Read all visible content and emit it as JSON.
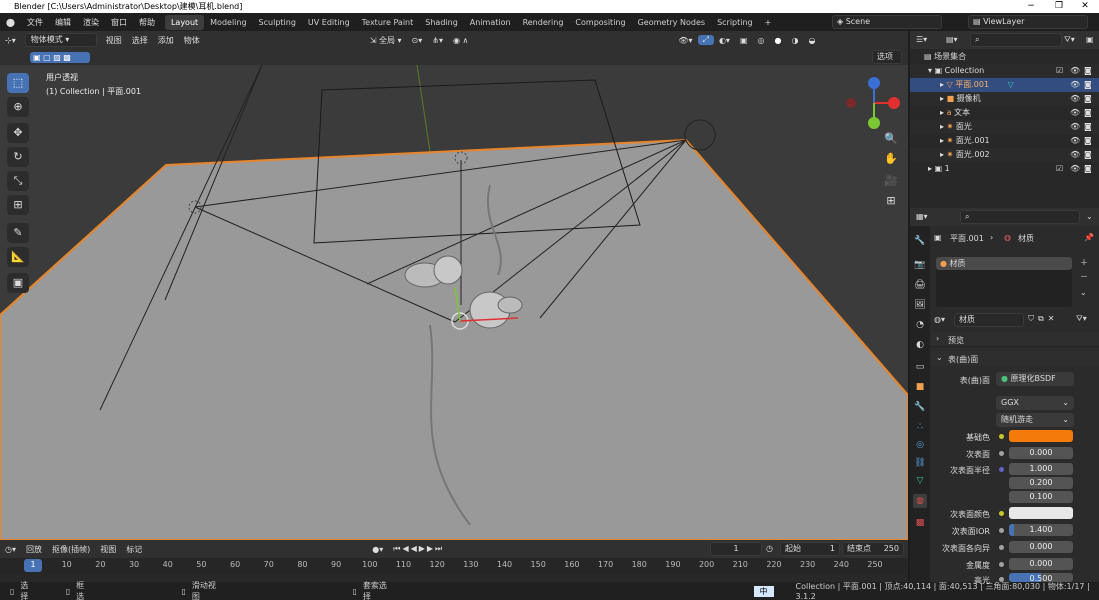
{
  "window": {
    "title": "Blender [C:\\Users\\Administrator\\Desktop\\建模\\耳机.blend]",
    "min": "−",
    "max": "❐",
    "close": "✕"
  },
  "menu": [
    "文件",
    "编辑",
    "渲染",
    "窗口",
    "帮助"
  ],
  "workspaces": [
    "Layout",
    "Modeling",
    "Sculpting",
    "UV Editing",
    "Texture Paint",
    "Shading",
    "Animation",
    "Rendering",
    "Compositing",
    "Geometry Nodes",
    "Scripting",
    "+"
  ],
  "scene": {
    "label": "Scene",
    "viewlayer": "ViewLayer"
  },
  "viewport_header": {
    "mode": "物体模式",
    "menus": [
      "视图",
      "选择",
      "添加",
      "物体"
    ],
    "orientation": "全局",
    "options": "选项"
  },
  "viewport": {
    "view_name": "用户透视",
    "collection_info": "(1) Collection | 平面.001"
  },
  "outliner": {
    "search_placeholder": "",
    "rows": [
      {
        "label": "场景集合",
        "icon": "scene-collection-icon"
      },
      {
        "label": "Collection",
        "icon": "collection-icon"
      },
      {
        "label": "平面.001",
        "icon": "mesh-icon"
      },
      {
        "label": "摄像机",
        "icon": "camera-icon"
      },
      {
        "label": "文本",
        "icon": "text-icon"
      },
      {
        "label": "面光",
        "icon": "light-icon"
      },
      {
        "label": "面光.001",
        "icon": "light-icon"
      },
      {
        "label": "面光.002",
        "icon": "light-icon"
      },
      {
        "label": "1",
        "icon": "collection-icon"
      }
    ]
  },
  "properties": {
    "breadcrumb_object": "平面.001",
    "breadcrumb_material": "材质",
    "slot_name": "材质",
    "material_name": "材质",
    "preview_label": "预览",
    "surface_label": "表(曲)面",
    "surface_field_label": "表(曲)面",
    "shader": "原理化BSDF",
    "distribution": "GGX",
    "subsurface_method": "随机游走",
    "rows": [
      {
        "label": "基础色",
        "value": ""
      },
      {
        "label": "次表面",
        "value": "0.000"
      },
      {
        "label": "次表面半径",
        "value": "1.000"
      },
      {
        "label": "",
        "value": "0.200"
      },
      {
        "label": "",
        "value": "0.100"
      },
      {
        "label": "次表面颜色",
        "value": ""
      },
      {
        "label": "次表面IOR",
        "value": "1.400"
      },
      {
        "label": "次表面各向异",
        "value": "0.000"
      },
      {
        "label": "金属度",
        "value": "0.000"
      },
      {
        "label": "高光",
        "value": "0.500"
      }
    ],
    "base_color": "#f47a0a"
  },
  "timeline": {
    "menus": [
      "回放",
      "抠像(插帧)",
      "视图",
      "标记"
    ],
    "current_frame": "1",
    "start_label": "起始",
    "start": "1",
    "end_label": "结束点",
    "end": "250",
    "ticks": [
      "1",
      "10",
      "20",
      "30",
      "40",
      "50",
      "60",
      "70",
      "80",
      "90",
      "100",
      "110",
      "120",
      "130",
      "140",
      "150",
      "160",
      "170",
      "180",
      "190",
      "200",
      "210",
      "220",
      "230",
      "240",
      "250"
    ]
  },
  "status": {
    "select": "选择",
    "box_select": "框选",
    "rotate_view": "滑动视图",
    "context_menu": "套索选择",
    "ime": "中",
    "info": "Collection | 平面.001 | 顶点:40,114 | 面:40,513 | 三角面:80,030 | 物体:1/17 | 3.1.2"
  }
}
